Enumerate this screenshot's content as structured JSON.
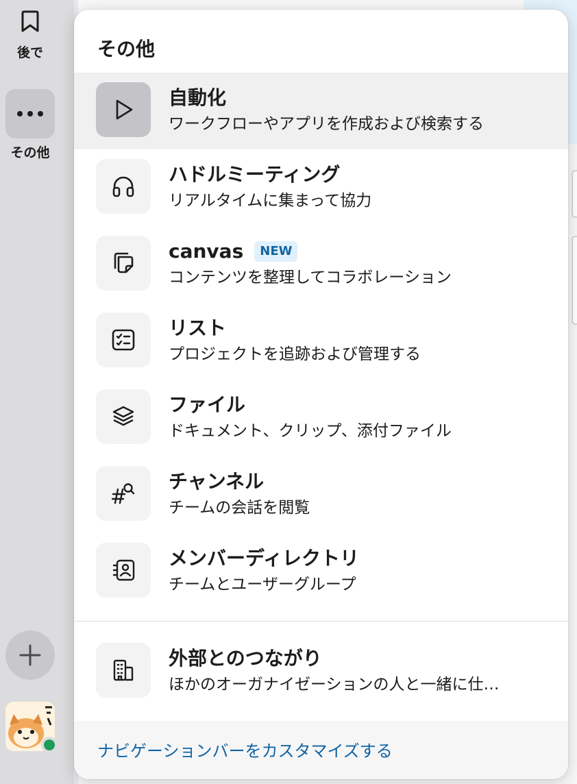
{
  "rail": {
    "later_label": "後で",
    "more_label": "その他",
    "later_icon": "bookmark-icon",
    "more_icon": "ellipsis-icon",
    "add_icon": "plus-icon",
    "presence_color": "#1f9d57"
  },
  "menu": {
    "title": "その他",
    "items": [
      {
        "icon": "play-icon",
        "title": "自動化",
        "subtitle": "ワークフローやアプリを作成および検索する"
      },
      {
        "icon": "headphones-icon",
        "title": "ハドルミーティング",
        "subtitle": "リアルタイムに集まって協力"
      },
      {
        "icon": "canvas-icon",
        "title": "canvas",
        "badge": "NEW",
        "subtitle": "コンテンツを整理してコラボレーション"
      },
      {
        "icon": "checklist-icon",
        "title": "リスト",
        "subtitle": "プロジェクトを追跡および管理する"
      },
      {
        "icon": "layers-icon",
        "title": "ファイル",
        "subtitle": "ドキュメント、クリップ、添付ファイル"
      },
      {
        "icon": "channel-search-icon",
        "title": "チャンネル",
        "subtitle": "チームの会話を閲覧"
      },
      {
        "icon": "contact-book-icon",
        "title": "メンバーディレクトリ",
        "subtitle": "チームとユーザーグループ"
      },
      {
        "icon": "building-icon",
        "title": "外部とのつながり",
        "subtitle": "ほかのオーガナイゼーションの人と一緒に仕…"
      }
    ],
    "footer_link": "ナビゲーションバーをカスタマイズする"
  },
  "colors": {
    "link": "#1264a3",
    "badge_bg": "#e0f1fb",
    "active_row": "#f0f0f1"
  }
}
